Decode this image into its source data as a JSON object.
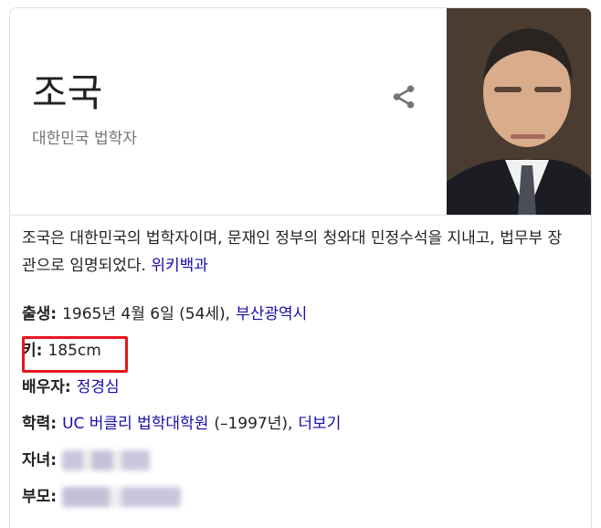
{
  "header": {
    "title": "조국",
    "subtitle": "대한민국 법학자"
  },
  "description": {
    "text": "조국은 대한민국의 법학자이며, 문재인 정부의 청와대 민정수석을 지내고, 법무부 장관으로 임명되었다. ",
    "source": "위키백과"
  },
  "facts": {
    "birth": {
      "label": "출생:",
      "value": "1965년 4월 6일 (54세),",
      "link": "부산광역시"
    },
    "height": {
      "label": "키:",
      "value": "185cm"
    },
    "spouse": {
      "label": "배우자:",
      "link": "정경심"
    },
    "education": {
      "label": "학력:",
      "link": "UC 버클리 법학대학원",
      "value": "(–1997년),",
      "more": "더보기"
    },
    "children": {
      "label": "자녀:"
    },
    "parents": {
      "label": "부모:"
    }
  },
  "colors": {
    "link": "#1a0dab",
    "highlight": "#e8141d",
    "subtitle": "#70757a"
  }
}
